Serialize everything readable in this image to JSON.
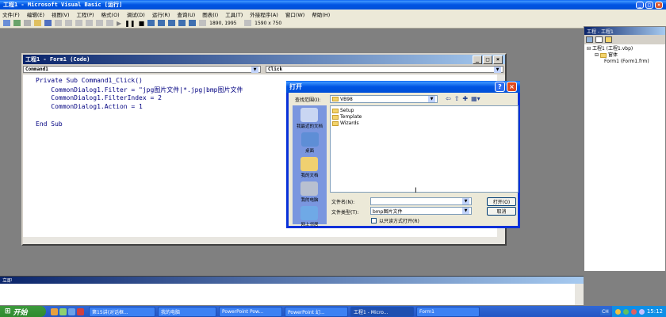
{
  "app": {
    "title": "工程1 - Microsoft Visual Basic [运行]"
  },
  "menu": [
    "文件(F)",
    "编辑(E)",
    "视图(V)",
    "工程(P)",
    "格式(O)",
    "调试(D)",
    "运行(R)",
    "查询(U)",
    "图表(I)",
    "工具(T)",
    "外接程序(A)",
    "窗口(W)",
    "帮助(H)"
  ],
  "toolbar": {
    "pos": "1890, 1995",
    "size": "1590 x 750"
  },
  "code_window": {
    "title": "工程1 - Form1 (Code)",
    "object": "Command1",
    "proc": "Click",
    "lines": [
      "Private Sub Command1_Click()",
      "    CommonDialog1.Filter = \"jpg图片文件|*.jpg|bmp图片文件",
      "    CommonDialog1.FilterIndex = 2",
      "    CommonDialog1.Action = 1",
      "",
      "End Sub"
    ]
  },
  "dialog": {
    "title": "打开",
    "lookin_label": "查找范围(I):",
    "lookin_value": "VB98",
    "places": [
      "我最近的文档",
      "桌面",
      "我的文档",
      "我的电脑",
      "网上邻居"
    ],
    "files": [
      "Setup",
      "Template",
      "Wizards"
    ],
    "filename_label": "文件名(N):",
    "filename_value": "",
    "filetype_label": "文件类型(T):",
    "filetype_value": "bmp图片文件",
    "readonly_label": "以只读方式打开(R)",
    "open_label": "打开(O)",
    "cancel_label": "取消"
  },
  "project": {
    "title": "工程 - 工程1",
    "root": "工程1 (工程1.vbp)",
    "folder": "窗体",
    "form": "Form1 (Form1.frm)"
  },
  "immediate": {
    "title": "立即"
  },
  "taskbar": {
    "start": "开始",
    "tasks": [
      "第15讲(对话框...",
      "我的电脑",
      "PowerPoint Pow...",
      "PowerPoint 幻...",
      "工程1 - Micro...",
      "Form1"
    ],
    "lang": "CH",
    "clock": "15:12"
  }
}
